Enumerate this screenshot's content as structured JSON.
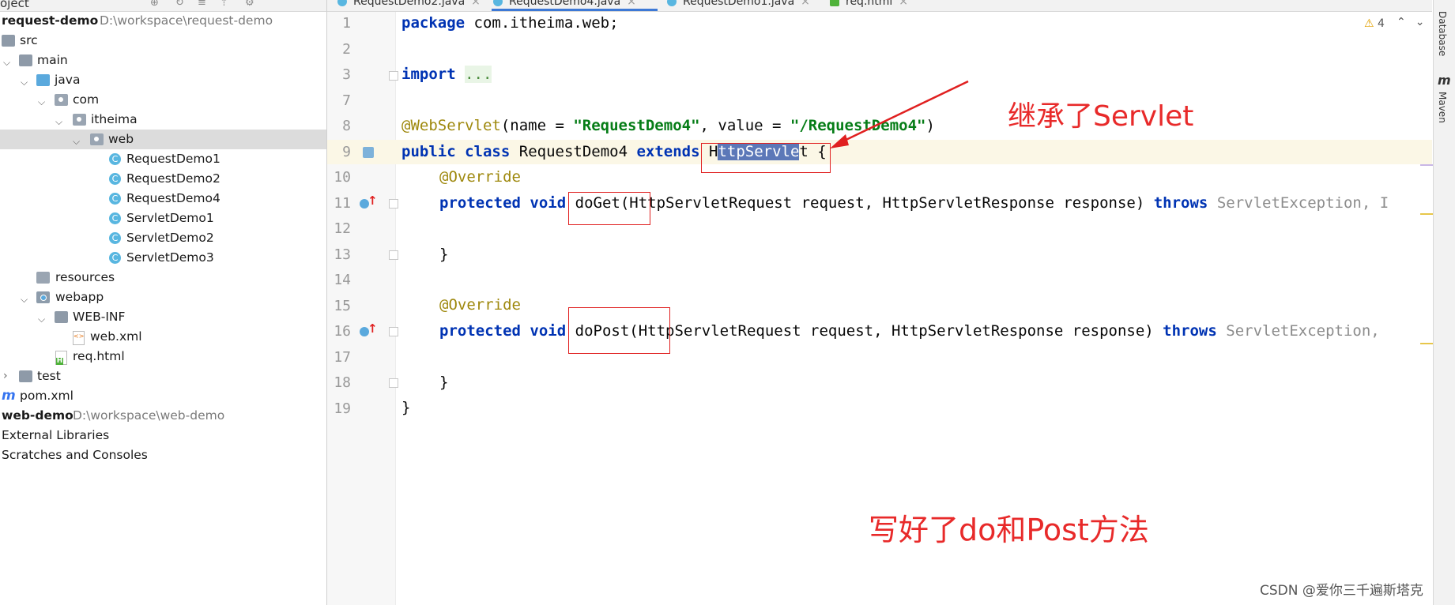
{
  "project_panel": {
    "title": "oject",
    "tree": [
      {
        "label": "request-demo",
        "path": "D:\\workspace\\request-demo",
        "bold": true
      },
      {
        "label": "src"
      },
      {
        "label": "main"
      },
      {
        "label": "java"
      },
      {
        "label": "com"
      },
      {
        "label": "itheima"
      },
      {
        "label": "web"
      },
      {
        "label": "RequestDemo1"
      },
      {
        "label": "RequestDemo2"
      },
      {
        "label": "RequestDemo4"
      },
      {
        "label": "ServletDemo1"
      },
      {
        "label": "ServletDemo2"
      },
      {
        "label": "ServletDemo3"
      },
      {
        "label": "resources"
      },
      {
        "label": "webapp"
      },
      {
        "label": "WEB-INF"
      },
      {
        "label": "web.xml"
      },
      {
        "label": "req.html"
      },
      {
        "label": "test"
      },
      {
        "label": "pom.xml"
      },
      {
        "label": "web-demo",
        "path": "D:\\workspace\\web-demo",
        "bold": true
      },
      {
        "label": "External Libraries"
      },
      {
        "label": "Scratches and Consoles"
      }
    ]
  },
  "tabs": [
    {
      "label": "RequestDemo2.java",
      "icon": "class-icon"
    },
    {
      "label": "RequestDemo4.java",
      "icon": "class-icon",
      "active": true
    },
    {
      "label": "RequestDemo1.java",
      "icon": "class-icon"
    },
    {
      "label": "req.html",
      "icon": "html-icon"
    }
  ],
  "inspection": {
    "warnings": "4"
  },
  "line_numbers": [
    "1",
    "2",
    "3",
    "7",
    "8",
    "9",
    "10",
    "11",
    "12",
    "13",
    "14",
    "15",
    "16",
    "17",
    "18",
    "19"
  ],
  "code": {
    "l1_kw": "package",
    "l1_rest": " com.itheima.web;",
    "l3_kw": "import",
    "l3_fold": "...",
    "l8_ann": "@WebServlet",
    "l8_a": "(name = ",
    "l8_s1": "\"RequestDemo4\"",
    "l8_b": ", value = ",
    "l8_s2": "\"/RequestDemo4\"",
    "l8_c": ")",
    "l9_kw1": "public",
    "l9_kw2": "class",
    "l9_name": "RequestDemo4",
    "l9_kw3": "extends",
    "l9_h": "H",
    "l9_sel": "ttpServle",
    "l9_t": "t {",
    "override": "@Override",
    "kw_protected": "protected",
    "kw_void": "void",
    "kw_throws": "throws",
    "l11_sig": "doGet(HttpServletRequest request, HttpServletResponse response)",
    "l11_exc": "ServletException, I",
    "l13": "}",
    "l16_sig": "doPost(HttpServletRequest request, HttpServletResponse response)",
    "l16_exc": "ServletException,",
    "l18": "}",
    "l19": "}"
  },
  "right_strip": {
    "database": "Database",
    "maven": "Maven",
    "maven_icon": "m"
  },
  "annotations": {
    "inherit_note": "继承了Servlet",
    "methods_note": "写好了do和Post方法"
  },
  "watermark": "CSDN @爱你三千遍斯塔克",
  "colors": {
    "keyword": "#0033b3",
    "string": "#067d17",
    "annotation": "#9e880d",
    "note_red": "#e82a2a",
    "selection": "#5c78b8"
  }
}
